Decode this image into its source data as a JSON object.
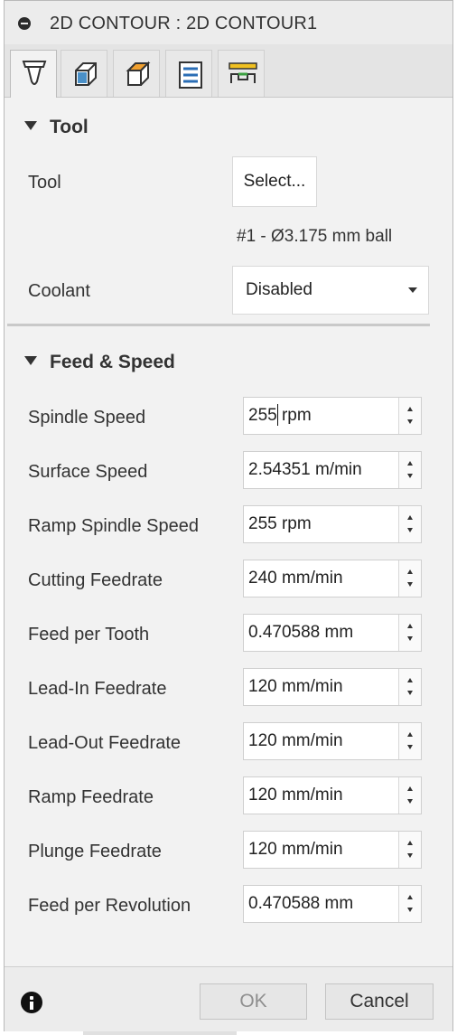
{
  "title": "2D CONTOUR : 2D CONTOUR1",
  "tabs": [
    {
      "icon": "tool-tab-icon",
      "active": true
    },
    {
      "icon": "geometry-tab-icon",
      "active": false
    },
    {
      "icon": "heights-tab-icon",
      "active": false
    },
    {
      "icon": "passes-tab-icon",
      "active": false
    },
    {
      "icon": "linking-tab-icon",
      "active": false
    }
  ],
  "tool_section": {
    "heading": "Tool",
    "tool_label": "Tool",
    "select_button": "Select...",
    "tool_info": "#1 - Ø3.175 mm ball",
    "coolant_label": "Coolant",
    "coolant_value": "Disabled"
  },
  "feed_section": {
    "heading": "Feed & Speed",
    "fields": [
      {
        "label": "Spindle Speed",
        "value": "255 rpm"
      },
      {
        "label": "Surface Speed",
        "value": "2.54351 m/min"
      },
      {
        "label": "Ramp Spindle Speed",
        "value": "255 rpm"
      },
      {
        "label": "Cutting Feedrate",
        "value": "240 mm/min"
      },
      {
        "label": "Feed per Tooth",
        "value": "0.470588 mm"
      },
      {
        "label": "Lead-In Feedrate",
        "value": "120 mm/min"
      },
      {
        "label": "Lead-Out Feedrate",
        "value": "120 mm/min"
      },
      {
        "label": "Ramp Feedrate",
        "value": "120 mm/min"
      },
      {
        "label": "Plunge Feedrate",
        "value": "120 mm/min"
      },
      {
        "label": "Feed per Revolution",
        "value": "0.470588 mm"
      }
    ]
  },
  "footer": {
    "ok_label": "OK",
    "cancel_label": "Cancel"
  }
}
